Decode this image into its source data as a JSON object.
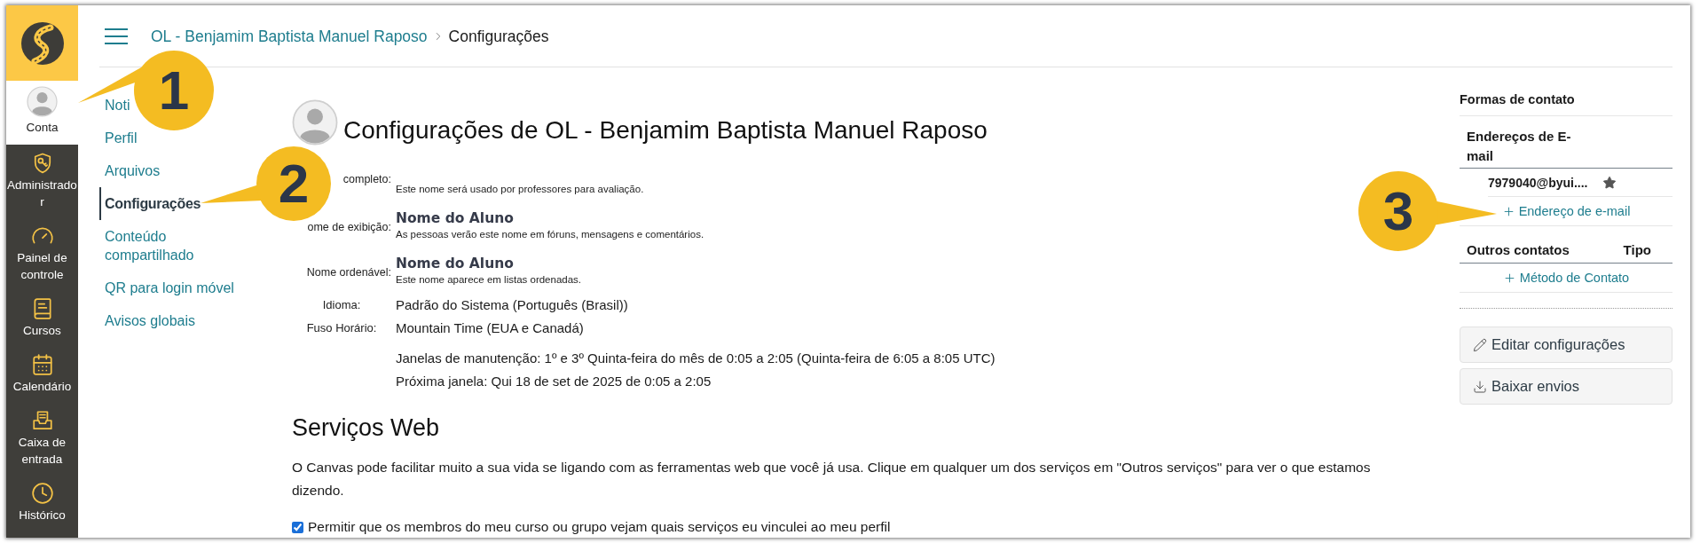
{
  "global_nav": {
    "items": [
      {
        "kind": "account",
        "label": "Conta",
        "selected": true
      },
      {
        "kind": "admin",
        "label": "Administrador",
        "selected": false
      },
      {
        "kind": "dashboard",
        "label": "Painel de controle",
        "selected": false
      },
      {
        "kind": "courses",
        "label": "Cursos",
        "selected": false
      },
      {
        "kind": "calendar",
        "label": "Calendário",
        "selected": false
      },
      {
        "kind": "inbox",
        "label": "Caixa de entrada",
        "selected": false
      },
      {
        "kind": "history",
        "label": "Histórico",
        "selected": false
      }
    ]
  },
  "breadcrumb": [
    {
      "kind": "link",
      "label": "OL - Benjamim Baptista Manuel Raposo"
    },
    {
      "kind": "current",
      "label": "Configurações"
    }
  ],
  "section_nav": {
    "items": [
      {
        "label": "Noti",
        "selected": false
      },
      {
        "label": "Perfil",
        "selected": false
      },
      {
        "label": "Arquivos",
        "selected": false
      },
      {
        "label": "Configurações",
        "selected": true
      },
      {
        "label": "Conteúdo compartilhado",
        "selected": false
      },
      {
        "label": "QR para login móvel",
        "selected": false
      },
      {
        "label": "Avisos globais",
        "selected": false
      }
    ]
  },
  "profile": {
    "title": "Configurações de OL - Benjamim Baptista Manuel Raposo",
    "fields": [
      {
        "kind": "name",
        "label": "completo:",
        "hint": "Este nome será usado por professores para avaliação."
      },
      {
        "kind": "name",
        "label": "ome de exibição:",
        "value": "Nome do Aluno",
        "hint": "As pessoas verão este nome em fóruns, mensagens e comentários."
      },
      {
        "kind": "name",
        "label": "Nome ordenável:",
        "value": "Nome do Aluno",
        "hint": "Este nome aparece em listas ordenadas."
      },
      {
        "kind": "text",
        "label": "Idioma:",
        "value": "Padrão do Sistema (Português (Brasil))"
      },
      {
        "kind": "text",
        "label": "Fuso Horário:",
        "value": "Mountain Time (EUA e Canadá)",
        "notes": [
          "Janelas de manutenção: 1º e 3º Quinta-feira do mês de 0:05 a 2:05 (Quinta-feira de 6:05 a 8:05 UTC)",
          "Próxima janela: Qui 18 de set de 2025 de 0:05 a 2:05"
        ]
      }
    ]
  },
  "web_services": {
    "heading": "Serviços Web",
    "description": "O Canvas pode facilitar muito a sua vida se ligando com as ferramentas web que você já usa. Clique em qualquer um dos serviços em \"Outros serviços\" para ver o que estamos dizendo.",
    "share_option": {
      "label": "Permitir que os membros do meu curso ou grupo vejam quais serviços eu vinculei ao meu perfil",
      "checked": true
    }
  },
  "contact": {
    "title": "Formas de contato",
    "email_heading": "Endereços de E-mail",
    "emails": [
      {
        "address": "7979040@byui....",
        "default": true
      }
    ],
    "add_email": "Endereço de e-mail",
    "other_heading": "Outros contatos",
    "type_heading": "Tipo",
    "add_method": "Método de Contato"
  },
  "actions": [
    {
      "kind": "edit",
      "label": "Editar configurações"
    },
    {
      "kind": "download",
      "label": "Baixar envios"
    }
  ],
  "callouts": [
    {
      "number": "1"
    },
    {
      "number": "2"
    },
    {
      "number": "3"
    }
  ]
}
